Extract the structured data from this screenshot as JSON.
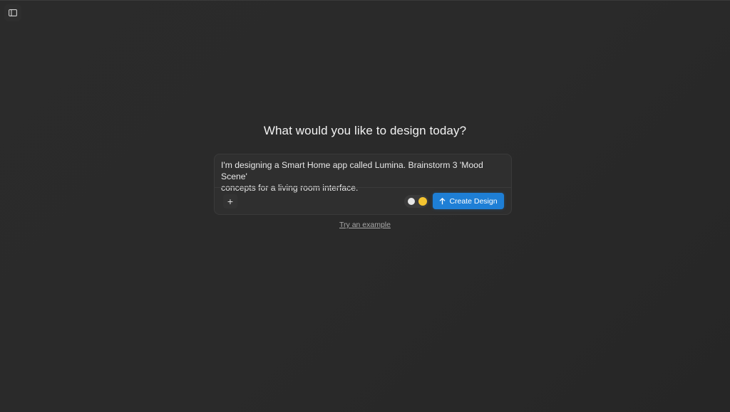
{
  "sidebar_toggle": {
    "icon": "sidebar-toggle-icon"
  },
  "heading": "What would you like to design today?",
  "composer": {
    "prompt": "I'm designing a Smart Home app called Lumina. Brainstorm 3 'Mood Scene'\nconcepts for a living room interface.",
    "add_label": "+",
    "theme_toggle": {
      "options": [
        "light",
        "yellow"
      ],
      "colors": {
        "light": "#e6e6e6",
        "yellow": "#f4c430"
      }
    },
    "create_button": {
      "label": "Create Design",
      "icon": "arrow-up-icon",
      "color": "#1e7fd6"
    }
  },
  "try_example": "Try an example"
}
